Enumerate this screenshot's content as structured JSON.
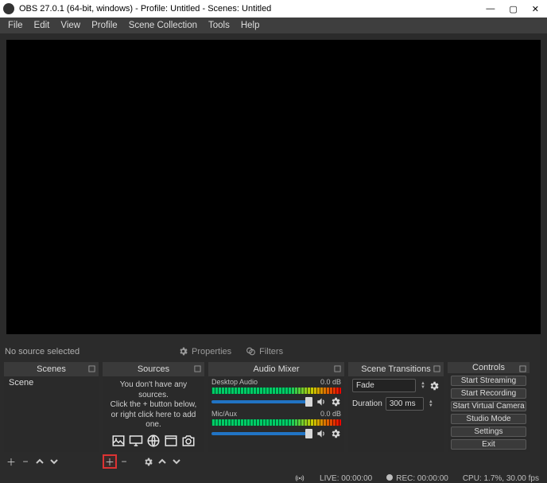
{
  "title": "OBS 27.0.1 (64-bit, windows) - Profile: Untitled - Scenes: Untitled",
  "menu": {
    "file": "File",
    "edit": "Edit",
    "view": "View",
    "profile": "Profile",
    "scenecoll": "Scene Collection",
    "tools": "Tools",
    "help": "Help"
  },
  "midbar": {
    "no_source": "No source selected",
    "properties": "Properties",
    "filters": "Filters"
  },
  "panels": {
    "scenes": {
      "title": "Scenes",
      "item": "Scene"
    },
    "sources": {
      "title": "Sources",
      "empty_l1": "You don't have any sources.",
      "empty_l2": "Click the + button below,",
      "empty_l3": "or right click here to add one."
    },
    "mixer": {
      "title": "Audio Mixer",
      "ch1": "Desktop Audio",
      "ch1_db": "0.0 dB",
      "ch2": "Mic/Aux",
      "ch2_db": "0.0 dB"
    },
    "trans": {
      "title": "Scene Transitions",
      "fade": "Fade",
      "duration_lbl": "Duration",
      "duration_val": "300 ms"
    },
    "ctrl": {
      "title": "Controls",
      "b1": "Start Streaming",
      "b2": "Start Recording",
      "b3": "Start Virtual Camera",
      "b4": "Studio Mode",
      "b5": "Settings",
      "b6": "Exit"
    }
  },
  "status": {
    "live": "LIVE: 00:00:00",
    "rec": "REC: 00:00:00",
    "cpu": "CPU: 1.7%, 30.00 fps"
  }
}
